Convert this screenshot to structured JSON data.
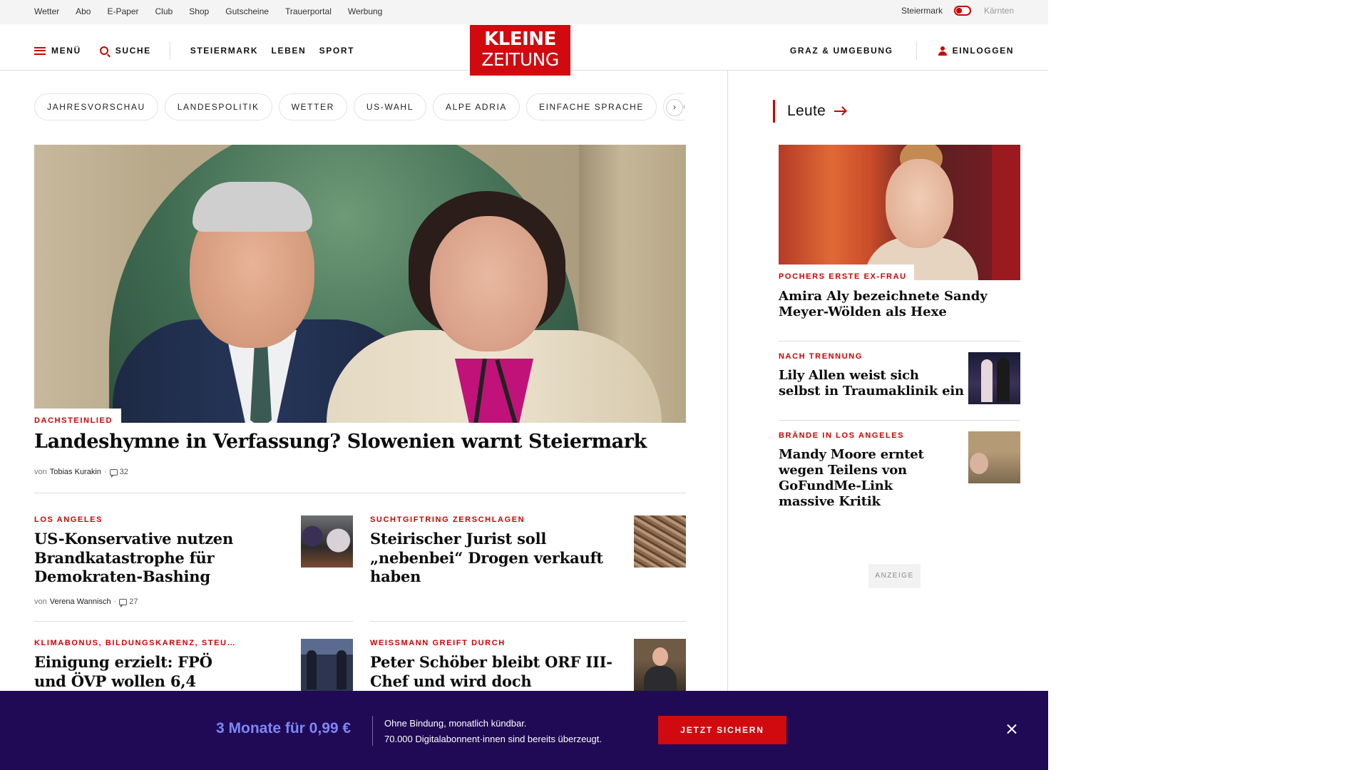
{
  "utility_nav": [
    "Wetter",
    "Abo",
    "E-Paper",
    "Club",
    "Shop",
    "Gutscheine",
    "Trauerportal",
    "Werbung"
  ],
  "region": {
    "active": "Steiermark",
    "inactive": "Kärnten"
  },
  "header": {
    "menu": "MENÜ",
    "search": "SUCHE",
    "sections": [
      "STEIERMARK",
      "LEBEN",
      "SPORT"
    ],
    "logo_line1": "KLEINE",
    "logo_line2": "ZEITUNG",
    "local": "GRAZ & UMGEBUNG",
    "login": "EINLOGGEN"
  },
  "topics": [
    "JAHRESVORSCHAU",
    "LANDESPOLITIK",
    "WETTER",
    "US-WAHL",
    "ALPE ADRIA",
    "EINFACHE SPRACHE",
    "DOS"
  ],
  "hero": {
    "kicker": "DACHSTEINLIED",
    "title": "Landeshymne in Verfassung? Slowenien warnt Steiermark",
    "by": "von",
    "author": "Tobias Kurakin",
    "comments": "32"
  },
  "teasers": [
    {
      "kicker": "LOS ANGELES",
      "title": "US-Konservative nutzen Brandkatastrophe für Demokraten-Bashing",
      "by": "von",
      "author": "Verena Wannisch",
      "comments": "27",
      "thumb": "wildfire-photo"
    },
    {
      "kicker": "SUCHTGIFTRING ZERSCHLAGEN",
      "title": "Steirischer Jurist soll „nebenbei“ Drogen verkauft haben",
      "thumb": "drugs-photo"
    },
    {
      "kicker": "KLIMABONUS, BILDUNGSKARENZ, STEU…",
      "title": "Einigung erzielt: FPÖ und ÖVP wollen 6,4",
      "thumb": "press-conference-photo"
    },
    {
      "kicker": "WEISSMANN GREIFT DURCH",
      "title": "Peter Schöber bleibt ORF III-Chef und wird doch entmachtet",
      "thumb": "portrait-photo"
    }
  ],
  "sidebar": {
    "heading": "Leute",
    "lead": {
      "kicker": "POCHERS ERSTE EX-FRAU",
      "title": "Amira Aly bezeichnete Sandy Meyer-Wölden als Hexe"
    },
    "items": [
      {
        "kicker": "NACH TRENNUNG",
        "title": "Lily Allen weist sich selbst in Traumaklinik ein",
        "thumb": "lily-allen-photo"
      },
      {
        "kicker": "BRÄNDE IN LOS ANGELES",
        "title": "Mandy Moore erntet wegen Teilens von GoFundMe-Link massive Kritik",
        "thumb": "mandy-moore-photo"
      }
    ],
    "ad_label": "ANZEIGE"
  },
  "banner": {
    "offer": "3 Monate für 0,99 €",
    "line1": "Ohne Bindung, monatlich kündbar.",
    "line2": "70.000 Digitalabonnent·innen sind bereits überzeugt.",
    "cta": "JETZT SICHERN"
  },
  "colors": {
    "brand_red": "#d10a10",
    "banner_bg": "#200a55",
    "offer_blue": "#7e87f5"
  }
}
